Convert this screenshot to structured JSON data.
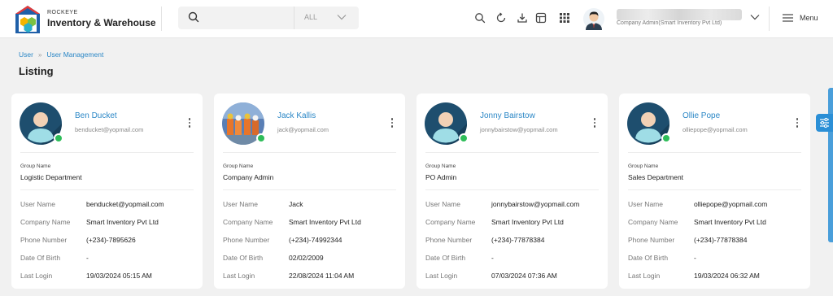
{
  "header": {
    "brand_small": "ROCKEYE",
    "brand_name": "Inventory & Warehouse",
    "search_placeholder": "",
    "search_filter": "ALL",
    "user_role": "Company Admin(Smart Inventory Pvt Ltd)",
    "menu_label": "Menu"
  },
  "breadcrumb": [
    "User",
    "User Management"
  ],
  "page_title": "Listing",
  "labels": {
    "group_name": "Group Name",
    "user_name": "User Name",
    "company_name": "Company Name",
    "phone_number": "Phone Number",
    "date_of_birth": "Date Of Birth",
    "last_login": "Last Login"
  },
  "cards": [
    {
      "name": "Ben Ducket",
      "email": "benducket@yopmail.com",
      "group": "Logistic Department",
      "user_name": "benducket@yopmail.com",
      "company": "Smart Inventory Pvt Ltd",
      "phone": "(+234)-7895626",
      "dob": "-",
      "last_login": "19/03/2024 05:15 AM",
      "avatar": "default-avatar-icon"
    },
    {
      "name": "Jack Kallis",
      "email": "jack@yopmail.com",
      "group": "Company Admin",
      "user_name": "Jack",
      "company": "Smart Inventory Pvt Ltd",
      "phone": "(+234)-74992344",
      "dob": "02/02/2009",
      "last_login": "22/08/2024 11:04 AM",
      "avatar": "photo"
    },
    {
      "name": "Jonny Bairstow",
      "email": "jonnybairstow@yopmail.com",
      "group": "PO Admin",
      "user_name": "jonnybairstow@yopmail.com",
      "company": "Smart Inventory Pvt Ltd",
      "phone": "(+234)-77878384",
      "dob": "-",
      "last_login": "07/03/2024 07:36 AM",
      "avatar": "default-avatar-icon"
    },
    {
      "name": "Ollie Pope",
      "email": "olliepope@yopmail.com",
      "group": "Sales Department",
      "user_name": "olliepope@yopmail.com",
      "company": "Smart Inventory Pvt Ltd",
      "phone": "(+234)-77878384",
      "dob": "-",
      "last_login": "19/03/2024 06:32 AM",
      "avatar": "default-avatar-icon"
    }
  ],
  "colors": {
    "accent": "#2b87c6",
    "online": "#2ebd59",
    "avatar_bg": "#1e4e6e"
  }
}
